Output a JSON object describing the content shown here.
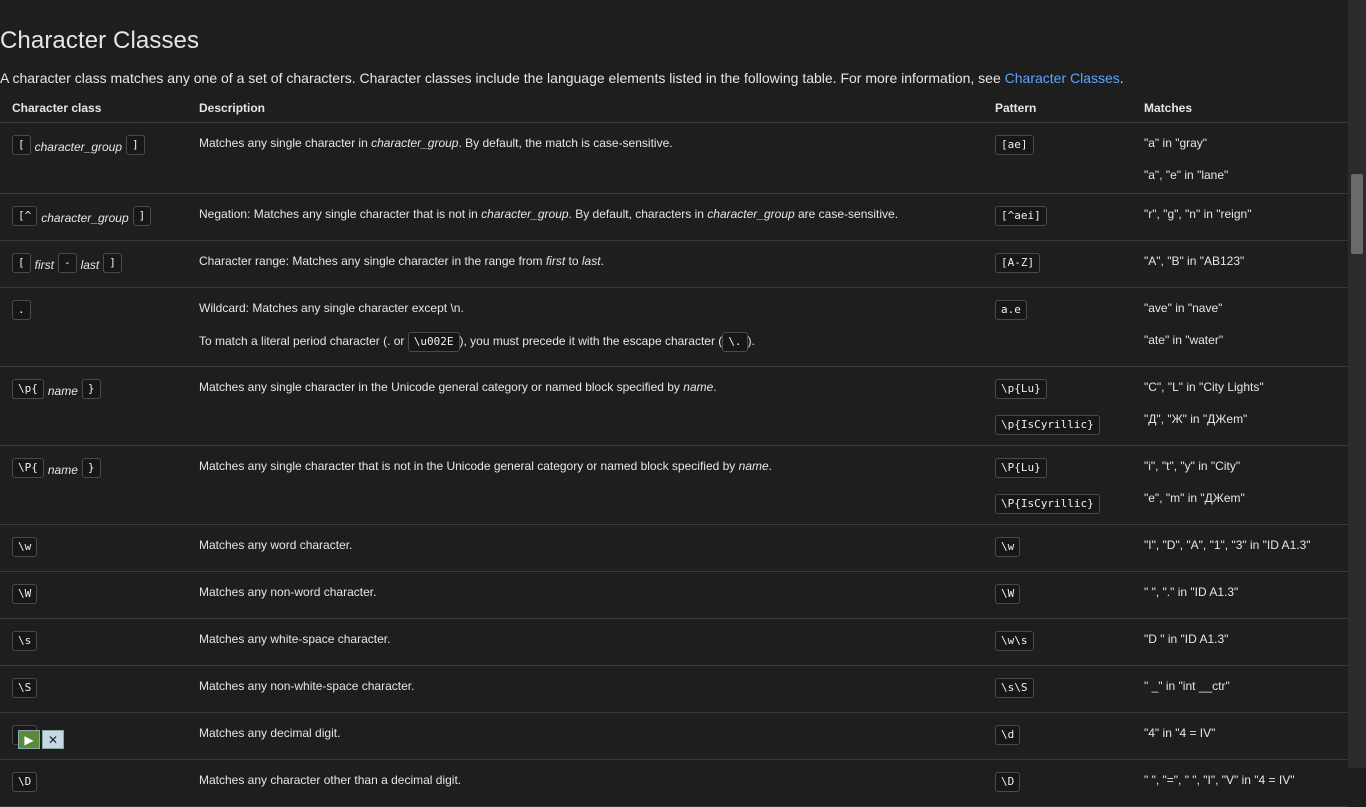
{
  "heading": "Character Classes",
  "intro": {
    "text": "A character class matches any one of a set of characters. Character classes include the language elements listed in the following table. For more information, see ",
    "link": "Character Classes",
    "end": "."
  },
  "table": {
    "headers": [
      "Character class",
      "Description",
      "Pattern",
      "Matches"
    ],
    "rows": [
      {
        "cls": [
          "[",
          "character_group",
          "]"
        ],
        "desc": [
          "Matches any single character in ",
          "character_group",
          ". By default, the match is case-sensitive."
        ],
        "patterns": [
          "[ae]"
        ],
        "matches": [
          "\"a\" in \"gray\"",
          "\"a\", \"e\" in \"lane\""
        ]
      },
      {
        "cls": [
          "[^",
          "character_group",
          "]"
        ],
        "desc": [
          "Negation: Matches any single character that is not in ",
          "character_group",
          ". By default, characters in ",
          "character_group",
          " are case-sensitive."
        ],
        "patterns": [
          "[^aei]"
        ],
        "matches": [
          "\"r\", \"g\", \"n\" in \"reign\""
        ]
      },
      {
        "cls": [
          "[",
          "first",
          "-",
          "last",
          "]"
        ],
        "desc": [
          "Character range: Matches any single character in the range from ",
          "first",
          " to ",
          "last",
          "."
        ],
        "patterns": [
          "[A-Z]"
        ],
        "matches": [
          "\"A\", \"B\" in \"AB123\""
        ]
      },
      {
        "cls": [
          "."
        ],
        "desc": [
          "Wildcard: Matches any single character except \\n."
        ],
        "desc2": [
          "To match a literal period character (. or ",
          "\\u002E",
          "), you must precede it with the escape character (",
          "\\.",
          ")."
        ],
        "patterns": [
          "a.e"
        ],
        "matches": [
          "\"ave\" in \"nave\"",
          "\"ate\" in \"water\""
        ]
      },
      {
        "cls": [
          "\\p{",
          "name",
          "}"
        ],
        "desc": [
          "Matches any single character in the Unicode general category or named block specified by ",
          "name",
          "."
        ],
        "patterns": [
          "\\p{Lu}",
          "\\p{IsCyrillic}"
        ],
        "matches": [
          "\"C\", \"L\" in \"City Lights\"",
          "\"Д\", \"Ж\" in \"ДЖem\""
        ]
      },
      {
        "cls": [
          "\\P{",
          "name",
          "}"
        ],
        "desc": [
          "Matches any single character that is not in the Unicode general category or named block specified by ",
          "name",
          "."
        ],
        "patterns": [
          "\\P{Lu}",
          "\\P{IsCyrillic}"
        ],
        "matches": [
          "\"i\", \"t\", \"y\" in \"City\"",
          "\"e\", \"m\" in \"ДЖem\""
        ]
      },
      {
        "cls": [
          "\\w"
        ],
        "desc": [
          "Matches any word character."
        ],
        "patterns": [
          "\\w"
        ],
        "matches": [
          "\"I\", \"D\", \"A\", \"1\", \"3\" in \"ID A1.3\""
        ]
      },
      {
        "cls": [
          "\\W"
        ],
        "desc": [
          "Matches any non-word character."
        ],
        "patterns": [
          "\\W"
        ],
        "matches": [
          "\" \", \".\" in \"ID A1.3\""
        ]
      },
      {
        "cls": [
          "\\s"
        ],
        "desc": [
          "Matches any white-space character."
        ],
        "patterns": [
          "\\w\\s"
        ],
        "matches": [
          "\"D \" in \"ID A1.3\""
        ]
      },
      {
        "cls": [
          "\\S"
        ],
        "desc": [
          "Matches any non-white-space character."
        ],
        "patterns": [
          "\\s\\S"
        ],
        "matches": [
          "\" _\" in \"int __ctr\""
        ]
      },
      {
        "cls": [
          "\\d"
        ],
        "desc": [
          "Matches any decimal digit."
        ],
        "patterns": [
          "\\d"
        ],
        "matches": [
          "\"4\" in \"4 = IV\""
        ]
      },
      {
        "cls": [
          "\\D"
        ],
        "desc": [
          "Matches any character other than a decimal digit."
        ],
        "patterns": [
          "\\D"
        ],
        "matches": [
          "\" \", \"=\", \" \", \"I\", \"V\" in \"4 = IV\""
        ]
      }
    ]
  },
  "media_controls": {
    "play_icon": "play-icon",
    "close_icon": "close-icon"
  }
}
